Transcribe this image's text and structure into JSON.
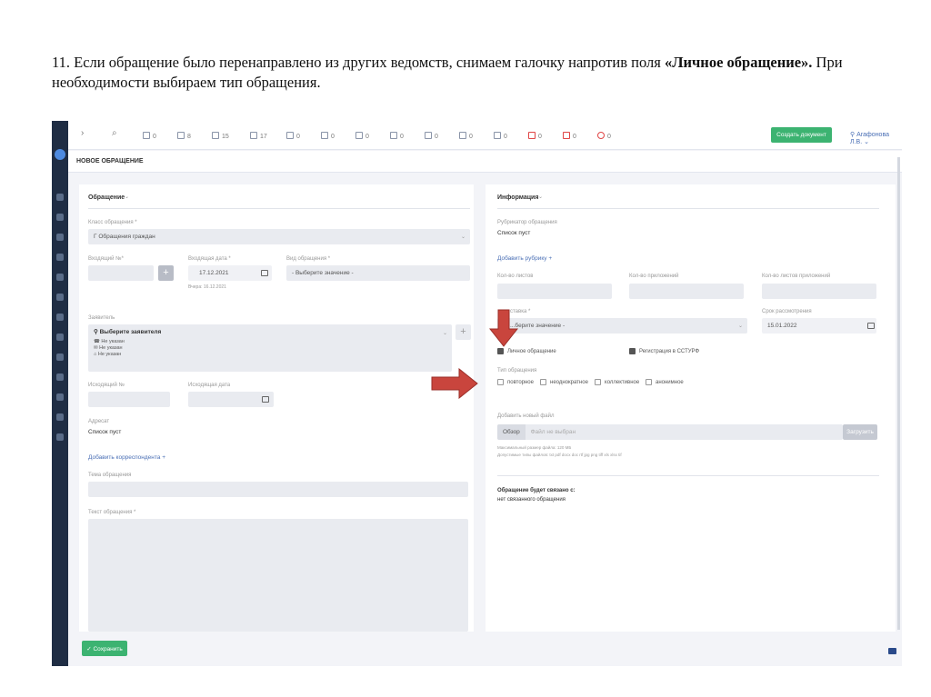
{
  "instruction": {
    "part1": "11. Если обращение было перенаправлено из других ведомств, снимаем  галочку напротив поля ",
    "bold": "«Личное обращение».",
    "part2": " При необходимости выбираем тип обращения."
  },
  "toolbar": {
    "back_glyph": "›",
    "search_glyph": "⌕",
    "counters": [
      "0",
      "8",
      "15",
      "17",
      "0",
      "0",
      "0",
      "0",
      "0",
      "0",
      "0",
      "0",
      "0",
      "0"
    ],
    "create_button": "Создать документ",
    "user": "Агафонова Л.В."
  },
  "page_title": "НОВОЕ ОБРАЩЕНИЕ",
  "left": {
    "section": "Обращение",
    "class_label": "Класс обращения *",
    "class_value": "Г Обращения граждан",
    "incoming_no_label": "Входящий №*",
    "incoming_date_label": "Входящая дата *",
    "incoming_date_value": "17.12.2021",
    "incoming_date_hint": "Вчера: 16.12.2021",
    "type_label": "Вид обращения *",
    "type_value": "- Выберите значение -",
    "applicant_label": "Заявитель",
    "applicant_value": "Выберите заявителя",
    "applicant_lines": [
      "Не указан",
      "Не указан",
      "Не указан"
    ],
    "outgoing_no_label": "Исходящий №",
    "outgoing_date_label": "Исходящая дата",
    "addressee_label": "Адресат",
    "addressee_value": "Список пуст",
    "add_correspondent": "Добавить корреспондента",
    "topic_label": "Тема обращения",
    "text_label": "Текст обращения *",
    "save_button": "✓ Сохранить"
  },
  "right": {
    "section": "Информация",
    "rubricator_label": "Рубрикатор обращения",
    "rubricator_value": "Список пуст",
    "add_rubric": "Добавить рубрику",
    "sheets_label": "Кол-во листов",
    "attachments_label": "Кол-во приложений",
    "attachment_sheets_label": "Кол-во листов приложений",
    "delivery_label": "...ставка *",
    "delivery_value": "...берите значение -",
    "review_label": "Срок рассмотрения",
    "review_value": "15.01.2022",
    "personal_label": "Личное обращение",
    "personal_checked": true,
    "sstu_label": "Регистрация в ССТУРФ",
    "sstu_checked": true,
    "kind_label": "Тип обращения",
    "kinds": [
      "повторное",
      "неоднократное",
      "коллективное",
      "анонимное"
    ],
    "file_label": "Добавить новый файл",
    "browse": "Обзор",
    "file_placeholder": "Файл не выбран",
    "upload": "Загрузить",
    "file_hint1": "Максимальный размер файла: 120 МБ",
    "file_hint2": "Допустимые типы файлов: txt pdf docx doc rtf jpg png tiff xls xlsx tif",
    "linked_label": "Обращение будет связано с:",
    "linked_value": "нет связанного обращения"
  },
  "colors": {
    "accent_green": "#3cb371",
    "sidebar": "#1f2d44",
    "arrow": "#c9453d",
    "link": "#4a6fb5"
  }
}
